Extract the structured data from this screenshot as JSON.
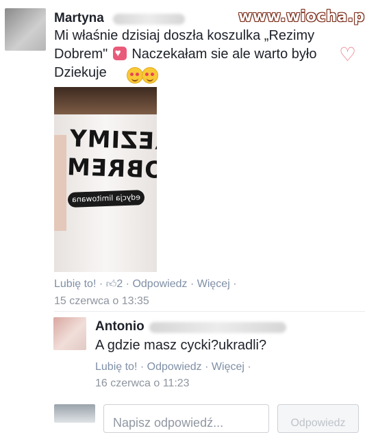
{
  "watermark": "www.wiocha.pl",
  "comment1": {
    "author": "Martyna",
    "line1": "Mi właśnie dzisiaj doszła koszulka „Rezimy",
    "line2_a": "Dobrem\"",
    "line2_b": "Naczekałam sie ale warto było",
    "line3": "Dziekuje",
    "shirt_line1": "REZIMY",
    "shirt_line2": "DOBREM",
    "shirt_line3": "edycja limitowana",
    "like": "Lubię to!",
    "sep1": "·",
    "like_count": "2",
    "sep2": "·",
    "reply": "Odpowiedz",
    "sep3": "·",
    "more": "Więcej",
    "sep4": "·",
    "time": "15 czerwca o 13:35"
  },
  "comment2": {
    "author": "Antonio",
    "text": "A gdzie masz cycki?ukradli?",
    "like": "Lubię to!",
    "sep1": "·",
    "reply": "Odpowiedz",
    "sep2": "·",
    "more": "Więcej",
    "sep3": "·",
    "time": "16 czerwca o 11:23"
  },
  "reply_form": {
    "placeholder": "Napisz odpowiedź...",
    "button": "Odpowiedz"
  },
  "colors": {
    "link": "#7f8fa6",
    "heart": "#e95a7a",
    "watermark_outline": "#7a2a16"
  }
}
